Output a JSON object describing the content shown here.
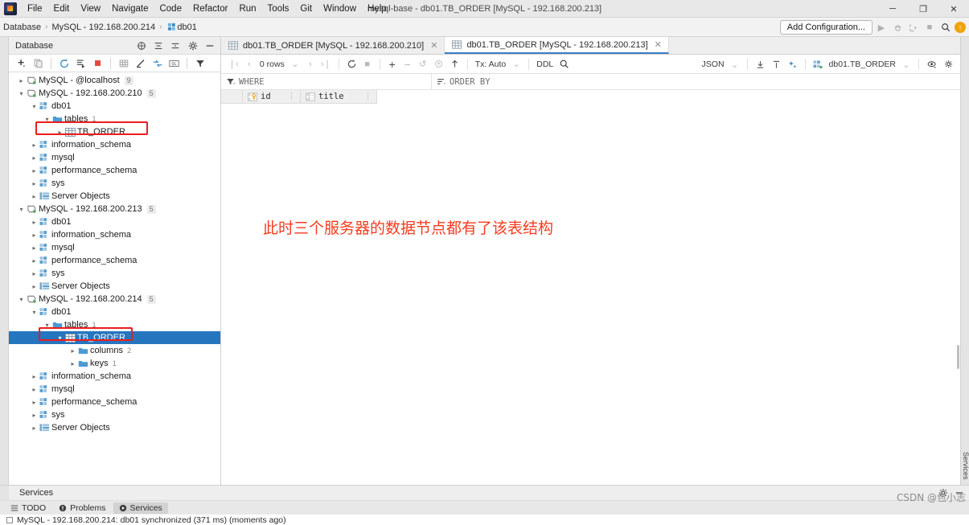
{
  "window": {
    "title": "mysql-base - db01.TB_ORDER [MySQL - 192.168.200.213]",
    "minimize": "─",
    "maximize": "❐",
    "close": "✕"
  },
  "menubar": {
    "items": [
      {
        "label": "File"
      },
      {
        "label": "Edit"
      },
      {
        "label": "View"
      },
      {
        "label": "Navigate"
      },
      {
        "label": "Code"
      },
      {
        "label": "Refactor"
      },
      {
        "label": "Run"
      },
      {
        "label": "Tools"
      },
      {
        "label": "Git"
      },
      {
        "label": "Window"
      },
      {
        "label": "Help"
      }
    ]
  },
  "breadcrumb": {
    "items": [
      {
        "label": "Database",
        "icon": "none"
      },
      {
        "label": "MySQL - 192.168.200.214",
        "icon": "none"
      },
      {
        "label": "db01",
        "icon": "schema-icon"
      }
    ],
    "separator": "›"
  },
  "run_toolbar": {
    "add_configuration": "Add Configuration...",
    "run_icon": "run-icon",
    "debug_icon": "debug-icon",
    "coverage_icon": "run-with-coverage-icon",
    "stop_icon": "stop-icon",
    "search_icon": "search-everywhere-icon",
    "update_badge": "↑"
  },
  "database_panel": {
    "title": "Database",
    "header_icons": [
      {
        "name": "group-by-icon",
        "glyph": "⊕"
      },
      {
        "name": "expand-all-icon",
        "glyph": "≡"
      },
      {
        "name": "collapse-all-icon",
        "glyph": "≔"
      },
      {
        "name": "settings-gear-icon",
        "glyph": "⚙"
      },
      {
        "name": "hide-panel-icon",
        "glyph": "─"
      }
    ],
    "toolbar_icons": [
      {
        "name": "add-new-icon",
        "glyph": "+"
      },
      {
        "name": "duplicate-icon",
        "glyph": "⧉"
      },
      {
        "name": "refresh-icon",
        "glyph": "↻"
      },
      {
        "name": "run-sql-script-icon",
        "glyph": "≣"
      },
      {
        "name": "stop-icon",
        "glyph": "■"
      },
      {
        "name": "open-data-editor-icon",
        "glyph": "▦"
      },
      {
        "name": "modify-icon",
        "glyph": "╱"
      },
      {
        "name": "sync-icon",
        "glyph": "⤴"
      },
      {
        "name": "query-console-icon",
        "glyph": "QL"
      },
      {
        "name": "filter-icon",
        "glyph": "▼"
      }
    ],
    "tree": [
      {
        "indent": 0,
        "twist": "›",
        "icon": "datasource-icon",
        "label": "MySQL - @localhost",
        "badge": "9",
        "count": "",
        "selected": false
      },
      {
        "indent": 0,
        "twist": "⌄",
        "icon": "datasource-icon",
        "label": "MySQL - 192.168.200.210",
        "badge": "5",
        "count": "",
        "selected": false
      },
      {
        "indent": 1,
        "twist": "⌄",
        "icon": "schema-icon",
        "label": "db01",
        "badge": "",
        "count": "",
        "selected": false
      },
      {
        "indent": 2,
        "twist": "⌄",
        "icon": "folder-icon",
        "label": "tables",
        "badge": "",
        "count": "1",
        "selected": false
      },
      {
        "indent": 3,
        "twist": "›",
        "icon": "table-icon",
        "label": "TB_ORDER",
        "badge": "",
        "count": "",
        "selected": false
      },
      {
        "indent": 1,
        "twist": "›",
        "icon": "schema-icon",
        "label": "information_schema",
        "badge": "",
        "count": "",
        "selected": false
      },
      {
        "indent": 1,
        "twist": "›",
        "icon": "schema-icon",
        "label": "mysql",
        "badge": "",
        "count": "",
        "selected": false
      },
      {
        "indent": 1,
        "twist": "›",
        "icon": "schema-icon",
        "label": "performance_schema",
        "badge": "",
        "count": "",
        "selected": false
      },
      {
        "indent": 1,
        "twist": "›",
        "icon": "schema-icon",
        "label": "sys",
        "badge": "",
        "count": "",
        "selected": false
      },
      {
        "indent": 1,
        "twist": "›",
        "icon": "server-objects-icon",
        "label": "Server Objects",
        "badge": "",
        "count": "",
        "selected": false
      },
      {
        "indent": 0,
        "twist": "⌄",
        "icon": "datasource-icon",
        "label": "MySQL - 192.168.200.213",
        "badge": "5",
        "count": "",
        "selected": false
      },
      {
        "indent": 1,
        "twist": "›",
        "icon": "schema-icon",
        "label": "db01",
        "badge": "",
        "count": "",
        "selected": false
      },
      {
        "indent": 1,
        "twist": "›",
        "icon": "schema-icon",
        "label": "information_schema",
        "badge": "",
        "count": "",
        "selected": false
      },
      {
        "indent": 1,
        "twist": "›",
        "icon": "schema-icon",
        "label": "mysql",
        "badge": "",
        "count": "",
        "selected": false
      },
      {
        "indent": 1,
        "twist": "›",
        "icon": "schema-icon",
        "label": "performance_schema",
        "badge": "",
        "count": "",
        "selected": false
      },
      {
        "indent": 1,
        "twist": "›",
        "icon": "schema-icon",
        "label": "sys",
        "badge": "",
        "count": "",
        "selected": false
      },
      {
        "indent": 1,
        "twist": "›",
        "icon": "server-objects-icon",
        "label": "Server Objects",
        "badge": "",
        "count": "",
        "selected": false
      },
      {
        "indent": 0,
        "twist": "⌄",
        "icon": "datasource-icon",
        "label": "MySQL - 192.168.200.214",
        "badge": "5",
        "count": "",
        "selected": false
      },
      {
        "indent": 1,
        "twist": "⌄",
        "icon": "schema-icon",
        "label": "db01",
        "badge": "",
        "count": "",
        "selected": false
      },
      {
        "indent": 2,
        "twist": "⌄",
        "icon": "folder-icon",
        "label": "tables",
        "badge": "",
        "count": "1",
        "selected": false
      },
      {
        "indent": 3,
        "twist": "⌄",
        "icon": "table-icon",
        "label": "TB_ORDER",
        "badge": "",
        "count": "",
        "selected": true
      },
      {
        "indent": 4,
        "twist": "›",
        "icon": "folder-icon",
        "label": "columns",
        "badge": "",
        "count": "2",
        "selected": false
      },
      {
        "indent": 4,
        "twist": "›",
        "icon": "folder-icon",
        "label": "keys",
        "badge": "",
        "count": "1",
        "selected": false
      },
      {
        "indent": 1,
        "twist": "›",
        "icon": "schema-icon",
        "label": "information_schema",
        "badge": "",
        "count": "",
        "selected": false
      },
      {
        "indent": 1,
        "twist": "›",
        "icon": "schema-icon",
        "label": "mysql",
        "badge": "",
        "count": "",
        "selected": false
      },
      {
        "indent": 1,
        "twist": "›",
        "icon": "schema-icon",
        "label": "performance_schema",
        "badge": "",
        "count": "",
        "selected": false
      },
      {
        "indent": 1,
        "twist": "›",
        "icon": "schema-icon",
        "label": "sys",
        "badge": "",
        "count": "",
        "selected": false
      },
      {
        "indent": 1,
        "twist": "›",
        "icon": "server-objects-icon",
        "label": "Server Objects",
        "badge": "",
        "count": "",
        "selected": false
      }
    ]
  },
  "editor": {
    "tabs": [
      {
        "label": "db01.TB_ORDER [MySQL - 192.168.200.210]",
        "active": false,
        "close": "✕"
      },
      {
        "label": "db01.TB_ORDER [MySQL - 192.168.200.213]",
        "active": true,
        "close": "✕"
      }
    ],
    "toolbar": {
      "first_page": "❘‹",
      "prev_page": "‹",
      "row_count": "0 rows",
      "row_count_caret": "⌄",
      "next_page": "›",
      "last_page": "›❘",
      "reload": "↻",
      "stop": "■",
      "add_row": "+",
      "delete_row": "−",
      "revert": "↺",
      "submit": "⇧",
      "upload": "↑",
      "tx_mode": "Tx: Auto",
      "tx_caret": "⌄",
      "ddl": "DDL",
      "search": "⌕",
      "format": "JSON",
      "format_caret": "⌄",
      "export_icon": "export-to-file-icon",
      "import_icon": "import-icon",
      "ai_icon": "ai-assistant-icon",
      "scope": "db01.TB_ORDER",
      "scope_caret": "⌄",
      "view_icon": "view-options-icon",
      "settings_icon": "data-settings-icon"
    },
    "filters": {
      "where_icon": "filter-icon",
      "where_label": "WHERE",
      "order_icon": "sort-icon",
      "order_label": "ORDER BY"
    },
    "grid": {
      "columns": [
        {
          "label": "id",
          "icon": "primary-key-icon",
          "sort": "⋮"
        },
        {
          "label": "title",
          "icon": "column-icon",
          "sort": "⋮"
        }
      ],
      "rows": []
    },
    "annotation": "此时三个服务器的数据节点都有了该表结构"
  },
  "services_panel": {
    "title": "Services",
    "settings_icon": "⚙",
    "hide_icon": "─"
  },
  "bottom_bar": {
    "items": [
      {
        "label": "TODO",
        "icon": "todo-icon",
        "glyph": "≡",
        "active": false
      },
      {
        "label": "Problems",
        "icon": "problems-icon",
        "glyph": "❗",
        "active": false
      },
      {
        "label": "Services",
        "icon": "services-icon",
        "glyph": "▶",
        "active": true
      }
    ]
  },
  "status": {
    "message": "MySQL - 192.168.200.214: db01 synchronized (371 ms) (moments ago)"
  },
  "watermark": {
    "text": "CSDN @包小志"
  },
  "colors": {
    "selection_blue": "#2675bf",
    "annotation_red": "#f53b1e",
    "highlight_box_red": "#ee1c1c",
    "tab_underline": "#3d7ec4"
  }
}
